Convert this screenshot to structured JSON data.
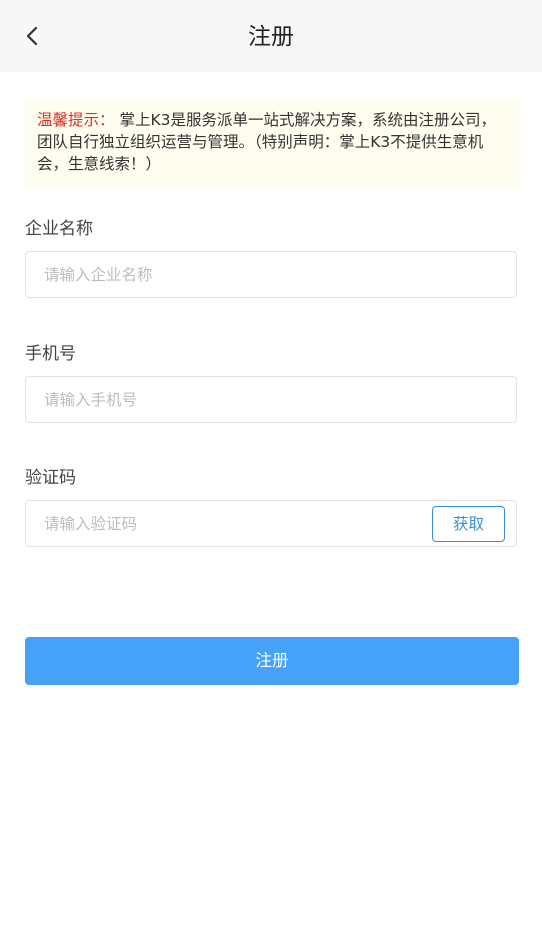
{
  "header": {
    "title": "注册",
    "back_icon": "chevron-left-icon"
  },
  "notice": {
    "label": "温馨提示：",
    "text": " 掌上K3是服务派单一站式解决方案，系统由注册公司，团队自行独立组织运营与管理。（特别声明：掌上K3不提供生意机会，生意线索！）"
  },
  "form": {
    "company": {
      "label": "企业名称",
      "placeholder": "请输入企业名称",
      "value": ""
    },
    "phone": {
      "label": "手机号",
      "placeholder": "请输入手机号",
      "value": ""
    },
    "code": {
      "label": "验证码",
      "placeholder": "请输入验证码",
      "value": "",
      "fetch_label": "获取"
    },
    "submit_label": "注册"
  },
  "colors": {
    "accent": "#45a2f8",
    "notice_label": "#e02e24",
    "notice_bg": "#fffdf0",
    "fetch_border": "#3a8fd8"
  }
}
